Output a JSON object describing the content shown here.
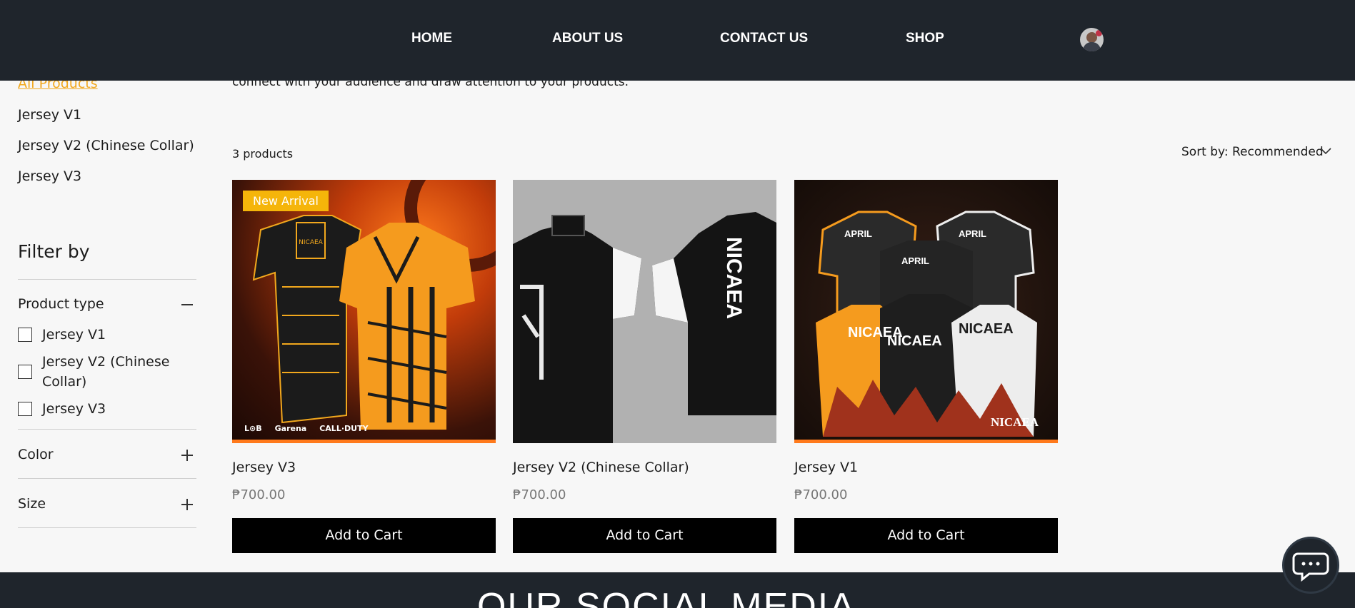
{
  "nav": {
    "items": [
      "HOME",
      "ABOUT US",
      "CONTACT US",
      "SHOP"
    ]
  },
  "sidebar": {
    "categories": [
      "All Products",
      "Jersey V1",
      "Jersey V2 (Chinese Collar)",
      "Jersey V3"
    ],
    "filter_title": "Filter by",
    "product_type_label": "Product type",
    "product_type_options": [
      "Jersey V1",
      "Jersey V2 (Chinese",
      "Collar)",
      "Jersey V3"
    ],
    "color_label": "Color",
    "size_label": "Size"
  },
  "main": {
    "description": "connect with your audience and draw attention to your products.",
    "count": "3 products",
    "sort_label": "Sort by: Recommended",
    "products": [
      {
        "name": "Jersey V3",
        "price": "₱700.00",
        "badge": "New Arrival",
        "button": "Add to Cart"
      },
      {
        "name": "Jersey V2 (Chinese Collar)",
        "price": "₱700.00",
        "button": "Add to Cart"
      },
      {
        "name": "Jersey V1",
        "price": "₱700.00",
        "button": "Add to Cart"
      }
    ],
    "image_text": {
      "logo_text": "NICAEA",
      "jersey_brand": "APRIL",
      "sponsors": [
        "L⊙B",
        "Garena",
        "CALL·DUTY"
      ]
    }
  },
  "footer": {
    "title": "OUR SOCIAL MEDIA"
  },
  "colors": {
    "header_bg": "#1f252c",
    "accent": "#f2a81d",
    "button_bg": "#000000",
    "badge_bg": "#f5b50a"
  }
}
